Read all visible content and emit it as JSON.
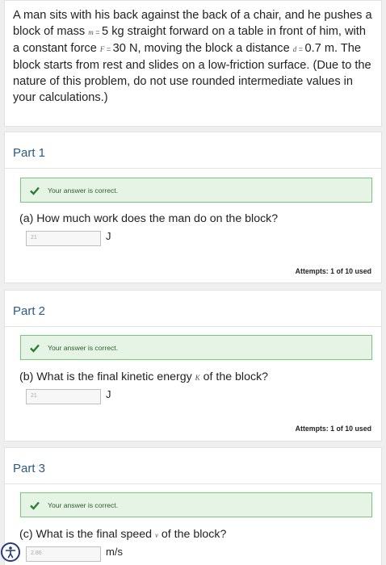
{
  "question": {
    "text_1": "A man sits with his back against the back of a chair, and he pushes a block of mass ",
    "var_m": "m",
    "eq_m": " = ",
    "val_m": " 5 kg straight forward on a table in front of him, with a constant force ",
    "var_F": "F",
    "eq_F": " = ",
    "val_F": " 30 N, moving the block a distance ",
    "var_d": "d",
    "eq_d": " = ",
    "val_d": " 0.7 m. The block starts from rest and slides on a low-friction surface. (Due to the nature of this problem, do not use rounded intermediate values in your calculations.)"
  },
  "parts": [
    {
      "title": "Part 1",
      "feedback": "Your answer is correct.",
      "question_pre": "(a) How much work does the man do on the block?",
      "question_var": "",
      "question_post": "",
      "answer_value": "21",
      "unit": "J",
      "attempts": "Attempts: 1 of 10 used"
    },
    {
      "title": "Part 2",
      "feedback": "Your answer is correct.",
      "question_pre": "(b) What is the final kinetic energy ",
      "question_var": "K",
      "question_post": " of the block?",
      "answer_value": "21",
      "unit": "J",
      "attempts": "Attempts: 1 of 10 used"
    },
    {
      "title": "Part 3",
      "feedback": "Your answer is correct.",
      "question_pre": "(c) What is the final speed ",
      "question_var": "v",
      "question_post": " of the block?",
      "answer_value": "2.86",
      "unit": "m/s"
    }
  ],
  "colors": {
    "part_title": "#2a5a86",
    "feedback_bg": "#e6f4e6",
    "feedback_border": "#7bc47b",
    "check": "#2e7d32"
  },
  "icons": {
    "check": "checkmark-icon",
    "accessibility": "accessibility-icon"
  }
}
